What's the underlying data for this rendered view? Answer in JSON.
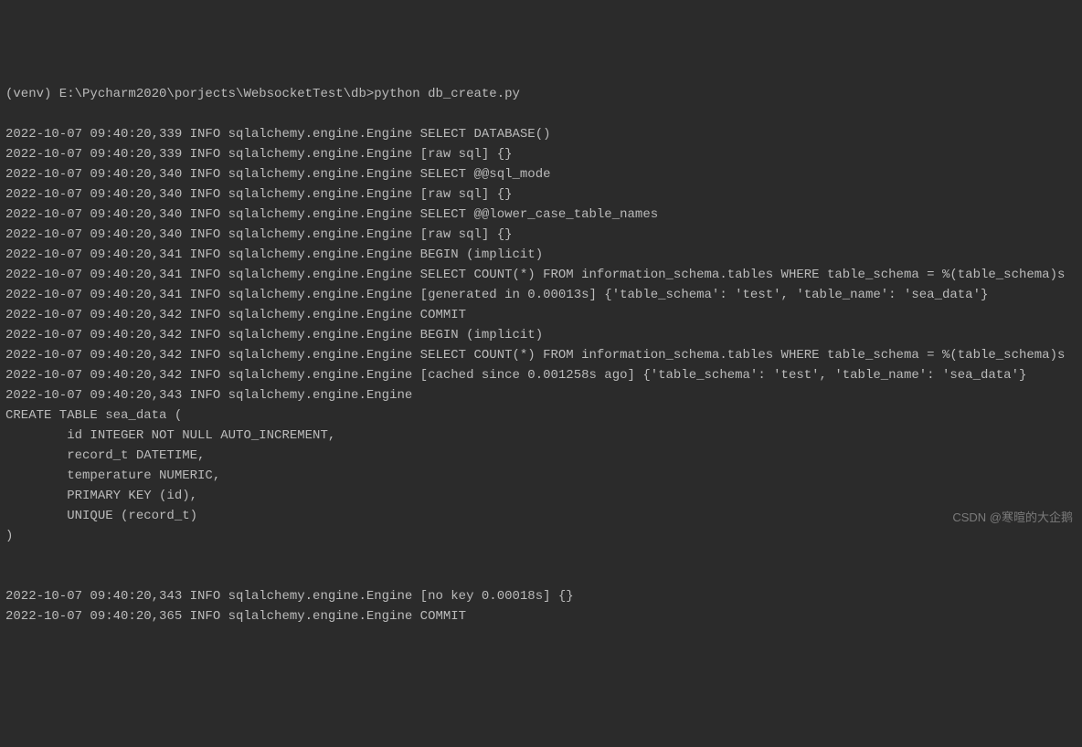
{
  "prompt": "(venv) E:\\Pycharm2020\\porjects\\WebsocketTest\\db>python db_create.py",
  "lines": [
    "2022-10-07 09:40:20,339 INFO sqlalchemy.engine.Engine SELECT DATABASE()",
    "2022-10-07 09:40:20,339 INFO sqlalchemy.engine.Engine [raw sql] {}",
    "2022-10-07 09:40:20,340 INFO sqlalchemy.engine.Engine SELECT @@sql_mode",
    "2022-10-07 09:40:20,340 INFO sqlalchemy.engine.Engine [raw sql] {}",
    "2022-10-07 09:40:20,340 INFO sqlalchemy.engine.Engine SELECT @@lower_case_table_names",
    "2022-10-07 09:40:20,340 INFO sqlalchemy.engine.Engine [raw sql] {}",
    "2022-10-07 09:40:20,341 INFO sqlalchemy.engine.Engine BEGIN (implicit)",
    "2022-10-07 09:40:20,341 INFO sqlalchemy.engine.Engine SELECT COUNT(*) FROM information_schema.tables WHERE table_schema = %(table_schema)s",
    "2022-10-07 09:40:20,341 INFO sqlalchemy.engine.Engine [generated in 0.00013s] {'table_schema': 'test', 'table_name': 'sea_data'}",
    "2022-10-07 09:40:20,342 INFO sqlalchemy.engine.Engine COMMIT",
    "2022-10-07 09:40:20,342 INFO sqlalchemy.engine.Engine BEGIN (implicit)",
    "2022-10-07 09:40:20,342 INFO sqlalchemy.engine.Engine SELECT COUNT(*) FROM information_schema.tables WHERE table_schema = %(table_schema)s",
    "2022-10-07 09:40:20,342 INFO sqlalchemy.engine.Engine [cached since 0.001258s ago] {'table_schema': 'test', 'table_name': 'sea_data'}",
    "2022-10-07 09:40:20,343 INFO sqlalchemy.engine.Engine ",
    "CREATE TABLE sea_data (",
    "        id INTEGER NOT NULL AUTO_INCREMENT, ",
    "        record_t DATETIME, ",
    "        temperature NUMERIC, ",
    "        PRIMARY KEY (id), ",
    "        UNIQUE (record_t)",
    ")",
    "",
    "",
    "2022-10-07 09:40:20,343 INFO sqlalchemy.engine.Engine [no key 0.00018s] {}",
    "2022-10-07 09:40:20,365 INFO sqlalchemy.engine.Engine COMMIT"
  ],
  "watermark": "CSDN @寒暄的大企鹅"
}
